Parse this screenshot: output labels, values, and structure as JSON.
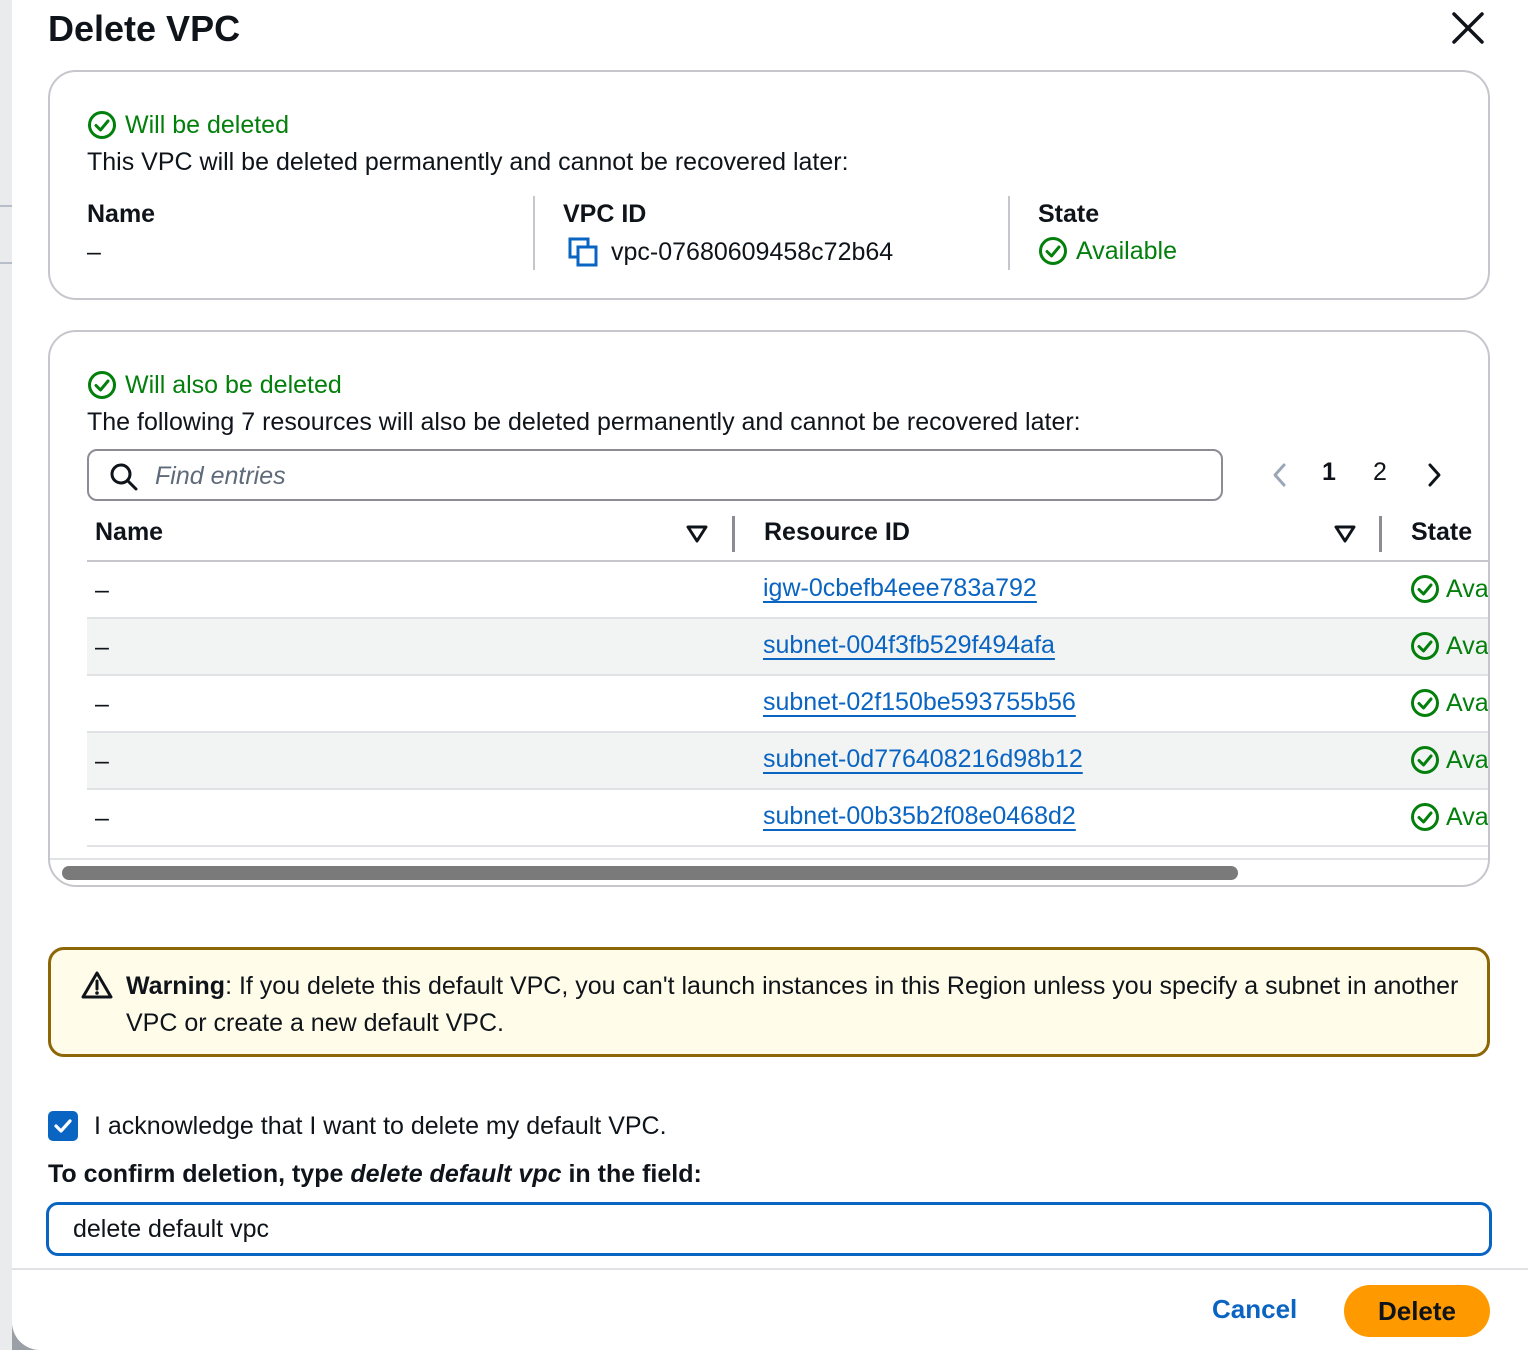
{
  "dialog": {
    "title": "Delete VPC",
    "close_icon": "close-icon"
  },
  "vpc_card": {
    "status": "Will be deleted",
    "description": "This VPC will be deleted permanently and cannot be recovered later:",
    "name_label": "Name",
    "name_value": "–",
    "vpc_id_label": "VPC ID",
    "vpc_id_value": "vpc-07680609458c72b64",
    "state_label": "State",
    "state_value": "Available"
  },
  "resources_card": {
    "status": "Will also be deleted",
    "description": "The following 7 resources will also be deleted permanently and cannot be recovered later:",
    "search_placeholder": "Find entries",
    "pagination": {
      "pages": [
        "1",
        "2"
      ],
      "current": "1"
    },
    "columns": [
      "Name",
      "Resource ID",
      "State"
    ],
    "rows": [
      {
        "name": "–",
        "resource_id": "igw-0cbefb4eee783a792",
        "state": "Ava"
      },
      {
        "name": "–",
        "resource_id": "subnet-004f3fb529f494afa",
        "state": "Ava"
      },
      {
        "name": "–",
        "resource_id": "subnet-02f150be593755b56",
        "state": "Ava"
      },
      {
        "name": "–",
        "resource_id": "subnet-0d776408216d98b12",
        "state": "Ava"
      },
      {
        "name": "–",
        "resource_id": "subnet-00b35b2f08e0468d2",
        "state": "Ava"
      }
    ]
  },
  "warning": {
    "title": "Warning",
    "text": ": If you delete this default VPC, you can't launch instances in this Region unless you specify a subnet in another VPC or create a new default VPC."
  },
  "acknowledge": {
    "label": "I acknowledge that I want to delete my default VPC.",
    "checked": true
  },
  "confirm": {
    "label_prefix": "To confirm deletion, type ",
    "label_phrase": "delete default vpc",
    "label_suffix": " in the field:",
    "value": "delete default vpc"
  },
  "footer": {
    "cancel_label": "Cancel",
    "delete_label": "Delete"
  },
  "colors": {
    "success": "#037f0c",
    "link": "#0a64c2",
    "primary_button": "#ff9900",
    "warning_border": "#8d6605",
    "warning_bg": "#fffce9"
  }
}
